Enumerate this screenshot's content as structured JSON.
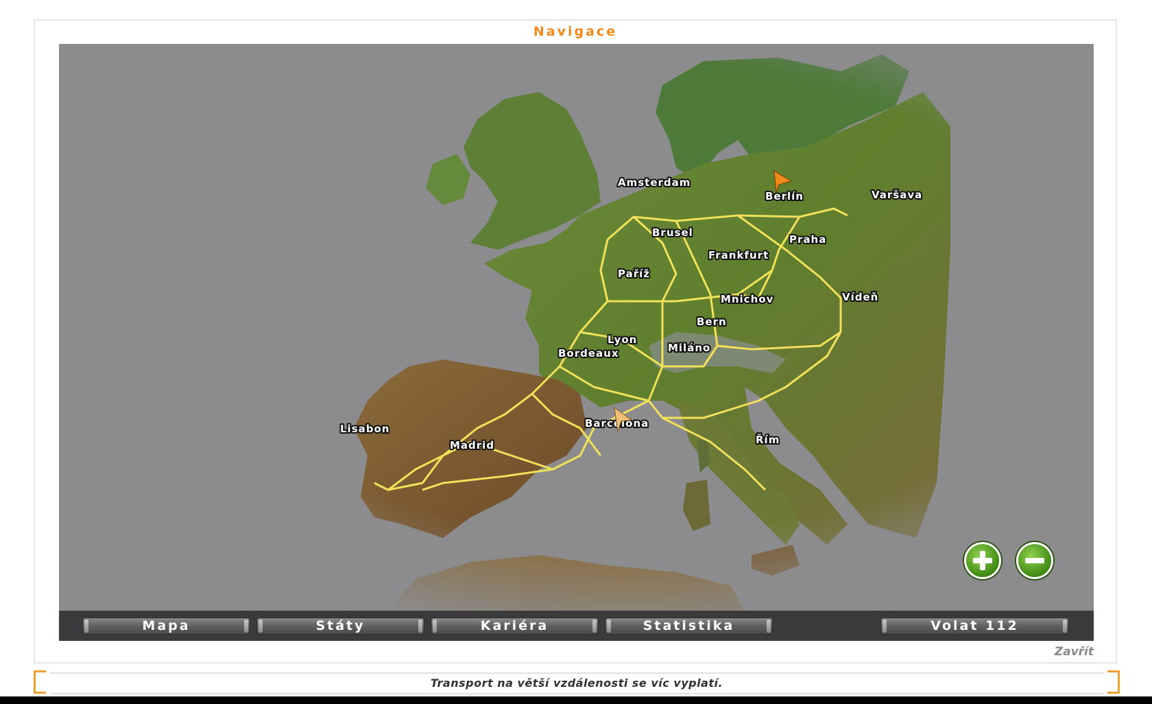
{
  "window": {
    "title": "Navigace"
  },
  "map": {
    "cities": [
      {
        "name": "Amsterdam"
      },
      {
        "name": "Berlín"
      },
      {
        "name": "Varšava"
      },
      {
        "name": "Brusel"
      },
      {
        "name": "Praha"
      },
      {
        "name": "Frankfurt"
      },
      {
        "name": "Paříž"
      },
      {
        "name": "Mnichov"
      },
      {
        "name": "Vídeň"
      },
      {
        "name": "Bern"
      },
      {
        "name": "Lyon"
      },
      {
        "name": "Bordeaux"
      },
      {
        "name": "Miláno"
      },
      {
        "name": "Lisabon"
      },
      {
        "name": "Barcelona"
      },
      {
        "name": "Madrid"
      },
      {
        "name": "Řím"
      }
    ],
    "zoom_in_icon": "plus-circle-icon",
    "zoom_out_icon": "minus-circle-icon",
    "colors": {
      "route": "#f2e25a",
      "sea": "#8c8c8e",
      "marker": "#f08a1c"
    }
  },
  "toolbar": {
    "map_label": "Mapa",
    "states_label": "Státy",
    "career_label": "Kariéra",
    "stats_label": "Statistika",
    "call_label": "Volat 112"
  },
  "close_label": "Zavřít",
  "tip_text": "Transport na větší vzdálenosti se víc vyplatí.",
  "colors": {
    "accent": "#f08a1c"
  }
}
